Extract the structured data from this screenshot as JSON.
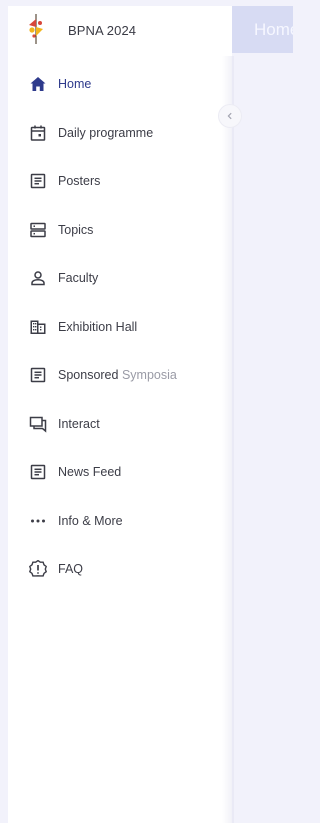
{
  "app": {
    "title": "BPNA 2024"
  },
  "topbar": {
    "title": "Home"
  },
  "colors": {
    "accent": "#2e3a8c",
    "text": "#3c3d47",
    "logo_red": "#d8473a",
    "logo_yellow": "#f2b51d"
  },
  "nav": {
    "items": [
      {
        "label": "Home",
        "icon": "home-icon",
        "active": true
      },
      {
        "label": "Daily programme",
        "icon": "calendar-icon"
      },
      {
        "label": "Posters",
        "icon": "document-icon"
      },
      {
        "label": "Topics",
        "icon": "server-icon"
      },
      {
        "label": "Faculty",
        "icon": "person-icon"
      },
      {
        "label": "Exhibition Hall",
        "icon": "building-icon"
      },
      {
        "label_main": "Sponsored",
        "label_muted": " Symposia",
        "icon": "document-icon"
      },
      {
        "label": "Interact",
        "icon": "chat-icon"
      },
      {
        "label": "News Feed",
        "icon": "document-icon"
      },
      {
        "label": "Info & More",
        "icon": "more-icon"
      },
      {
        "label": "FAQ",
        "icon": "alert-badge-icon"
      }
    ]
  }
}
